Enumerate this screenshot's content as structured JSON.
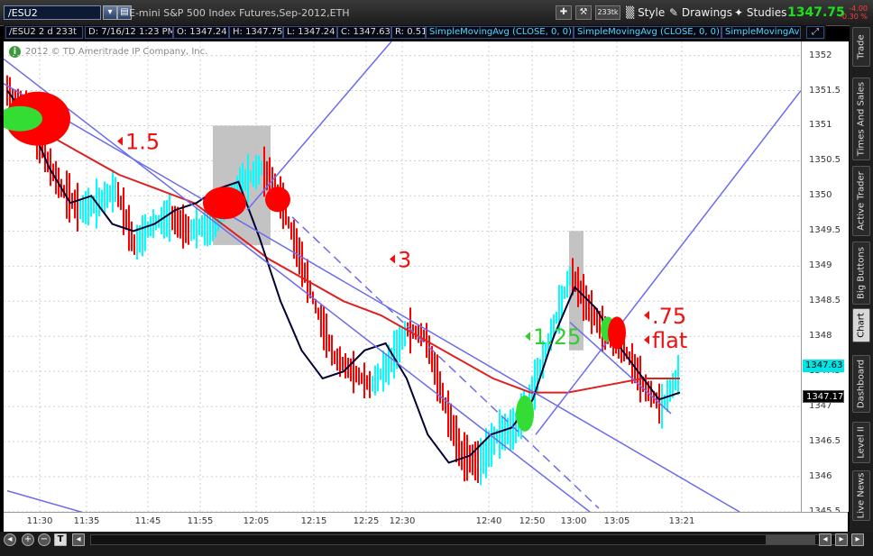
{
  "toolbar": {
    "symbol": "/ESU2",
    "description": "E-mini S&P 500 Index Futures,Sep-2012,ETH",
    "tick_count": "233tk",
    "style_label": "Style",
    "drawings_label": "Drawings",
    "studies_label": "Studies",
    "last_price": "1347.75",
    "change": "-4.00",
    "change_pct": "-0.30 %"
  },
  "infobar": {
    "symbol": "/ESU2 2 d 233t",
    "date": "D: 7/16/12 1:23 PM",
    "open": "O: 1347.24",
    "high": "H: 1347.75",
    "low": "L: 1347.24",
    "close": "C: 1347.63",
    "range": "R: 0.51",
    "sma1": "SimpleMovingAvg (CLOSE, 0, 0)",
    "sma2": "SimpleMovingAvg (CLOSE, 0, 0)",
    "sma3": "SimpleMovingAvg"
  },
  "copyright": "2012 © TD Ameritrade IP Company, Inc.",
  "sidebar": {
    "tabs": [
      "Trade",
      "Times And Sales",
      "Active Trader",
      "Big Buttons",
      "Chart",
      "Dashboard",
      "Level II",
      "Live News"
    ]
  },
  "price_boxes": {
    "last": "1347.63",
    "avg": "1347.17"
  },
  "annotations": [
    "1.5",
    "3",
    "1.25",
    ".75",
    "flat"
  ],
  "colors": {
    "up": "#00ffff",
    "down": "#ff0000",
    "ma_fast": "#000033",
    "ma_slow": "#e02020",
    "trend": "#6b6bef",
    "green": "#33dd33"
  },
  "chart_data": {
    "type": "line",
    "title": "/ESU2 2 d 233t",
    "ylim": [
      1345.5,
      1352.2
    ],
    "yticks": [
      "1352",
      "1351.5",
      "1351",
      "1350.5",
      "1350",
      "1349.5",
      "1349",
      "1348.5",
      "1348",
      "1347.5",
      "1347",
      "1346.5",
      "1346",
      "1345.5"
    ],
    "xticks": [
      "11:30",
      "11:35",
      "11:45",
      "11:55",
      "12:05",
      "12:15",
      "12:25",
      "12:30",
      "12:40",
      "12:50",
      "13:00",
      "13:05",
      "13:21"
    ],
    "grid": true,
    "series": [
      {
        "name": "price",
        "values": [
          1351.5,
          1351.2,
          1350.6,
          1350.1,
          1349.8,
          1349.9,
          1350.1,
          1349.3,
          1349.6,
          1349.7,
          1349.5,
          1349.6,
          1349.9,
          1350.2,
          1350.4,
          1350.0,
          1349.2,
          1348.4,
          1347.7,
          1347.5,
          1347.3,
          1347.6,
          1348.1,
          1348.0,
          1347.1,
          1346.3,
          1346.2,
          1346.6,
          1346.7,
          1347.3,
          1348.1,
          1348.9,
          1348.4,
          1348.0,
          1347.8,
          1347.3,
          1347.0,
          1347.5
        ]
      },
      {
        "name": "SimpleMovingAvg",
        "values": [
          1351.5,
          1351.1,
          1350.4,
          1349.9,
          1350.0,
          1349.6,
          1349.5,
          1349.6,
          1349.8,
          1349.9,
          1350.1,
          1350.2,
          1349.4,
          1348.5,
          1347.8,
          1347.4,
          1347.5,
          1347.8,
          1347.9,
          1347.4,
          1346.6,
          1346.2,
          1346.3,
          1346.6,
          1346.7,
          1347.1,
          1348.0,
          1348.7,
          1348.4,
          1347.9,
          1347.5,
          1347.1,
          1347.2
        ]
      },
      {
        "name": "SimpleMovingAvg",
        "values": [
          1351.0,
          1350.9,
          1350.6,
          1350.3,
          1350.1,
          1349.9,
          1349.5,
          1349.1,
          1348.8,
          1348.5,
          1348.3,
          1348.0,
          1347.7,
          1347.4,
          1347.2,
          1347.2,
          1347.3,
          1347.4,
          1347.4
        ]
      }
    ]
  }
}
